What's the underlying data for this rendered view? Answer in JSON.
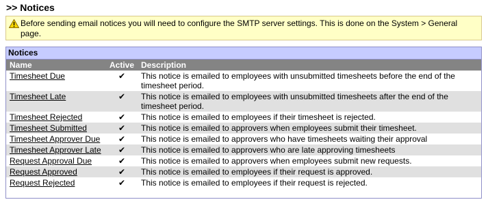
{
  "page": {
    "title": ">> Notices"
  },
  "warning": {
    "icon": "warning-triangle-icon",
    "text": "Before sending email notices you will need to configure the SMTP server settings. This is done on the System > General page."
  },
  "panel": {
    "title": "Notices",
    "columns": {
      "name": "Name",
      "active": "Active",
      "description": "Description"
    },
    "rows": [
      {
        "name": "Timesheet Due",
        "active": "✔",
        "description": "This notice is emailed to employees with unsubmitted timesheets before the end of the timesheet period."
      },
      {
        "name": "Timesheet Late",
        "active": "✔",
        "description": "This notice is emailed to employees with unsubmitted timesheets after the end of the timesheet period."
      },
      {
        "name": "Timesheet Rejected",
        "active": "✔",
        "description": "This notice is emailed to employees if their timesheet is rejected."
      },
      {
        "name": "Timesheet Submitted",
        "active": "✔",
        "description": "This notice is emailed to approvers when employees submit their timesheet."
      },
      {
        "name": "Timesheet Approver Due",
        "active": "✔",
        "description": "This notice is emailed to approvers who have timesheets waiting their approval"
      },
      {
        "name": "Timesheet Approver Late",
        "active": "✔",
        "description": "This notice is emailed to approvers who are late approving timesheets"
      },
      {
        "name": "Request Approval Due",
        "active": "✔",
        "description": "This notice is emailed to approvers when employees submit new requests."
      },
      {
        "name": "Request Approved",
        "active": "✔",
        "description": "This notice is emailed to employees if their request is approved."
      },
      {
        "name": "Request Rejected",
        "active": "✔",
        "description": "This notice is emailed to employees if their request is rejected."
      }
    ]
  }
}
